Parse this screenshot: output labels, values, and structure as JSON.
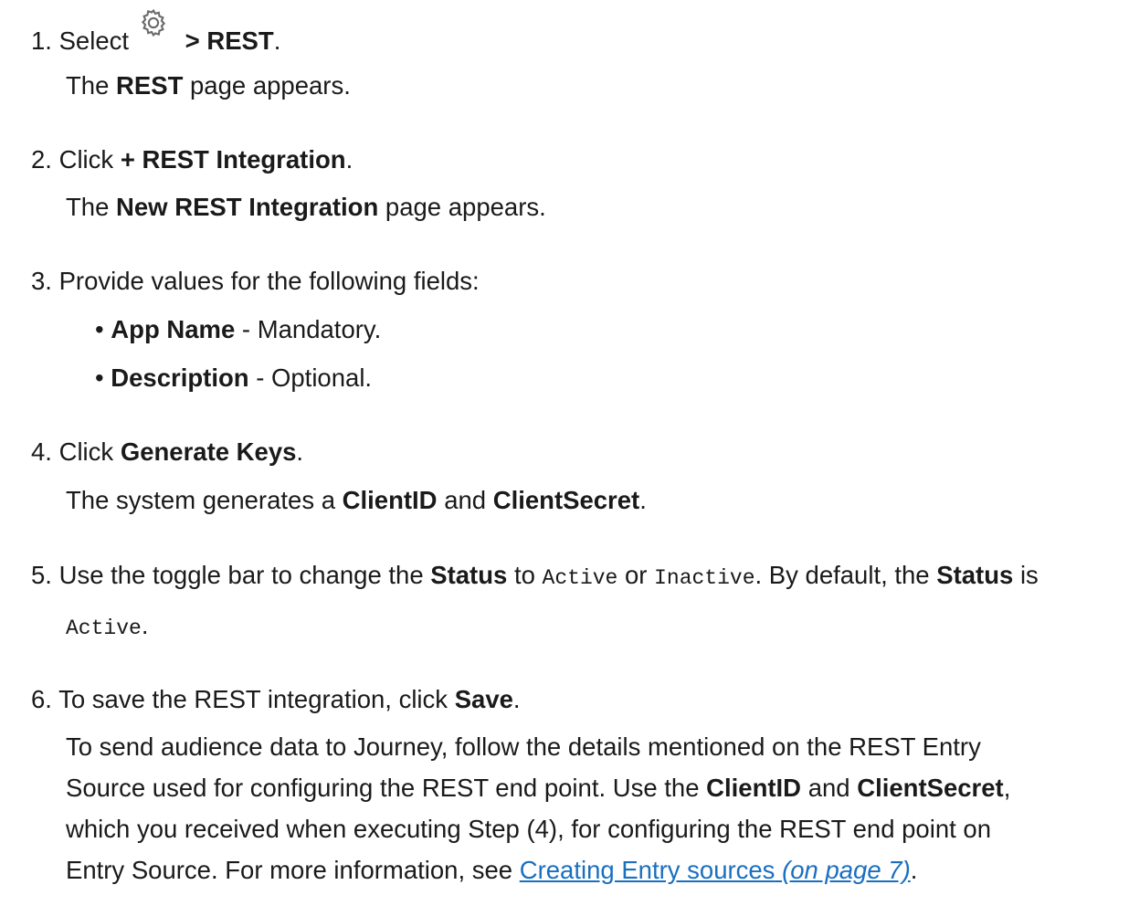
{
  "steps": [
    {
      "num": "1.",
      "lead": "Select",
      "icon": "gear-icon",
      "path": "> REST",
      "end": ".",
      "result": {
        "pre": "The",
        "bold": "REST",
        "post": "page appears."
      }
    },
    {
      "num": "2.",
      "lead": "Click",
      "bold": "+ REST Integration",
      "end": ".",
      "result": {
        "pre": "The",
        "bold": "New REST Integration",
        "post": "page appears."
      }
    },
    {
      "num": "3.",
      "text": "Provide values for the following fields:",
      "fields": [
        {
          "name": "App Name",
          "desc": " - Mandatory."
        },
        {
          "name": "Description",
          "desc": " - Optional."
        }
      ]
    },
    {
      "num": "4.",
      "lead": "Click",
      "bold": "Generate Keys",
      "end": ".",
      "result": {
        "pre": "The system generates a",
        "b1": "ClientID",
        "mid": "and",
        "b2": "ClientSecret",
        "end": "."
      }
    },
    {
      "num": "5.",
      "t1": "Use the toggle bar to change the",
      "b1": "Status",
      "t2": "to",
      "c1": "Active",
      "t3": "or",
      "c2": "Inactive",
      "t4": ". By default, the",
      "b2": "Status",
      "t5": "is",
      "c3": "Active",
      "end": "."
    },
    {
      "num": "6.",
      "lead": "To save the REST integration, click",
      "bold": "Save",
      "end": ".",
      "para": {
        "l1": "To send audience data to Journey, follow the details mentioned on the REST Entry",
        "l2a": "Source used for configuring the REST end point. Use the",
        "l2b": "ClientID",
        "l2c": "and",
        "l2d": "ClientSecret",
        "l2e": ",",
        "l3": "which you received when executing Step (4), for configuring the REST end point on",
        "l4a": "Entry Source. For more information, see",
        "link": "Creating Entry sources",
        "ref": "(on page 7)",
        "l4e": "."
      }
    }
  ],
  "colors": {
    "text": "#1a1a1a",
    "link": "#1a6fc0",
    "icon": "#6b6b6b"
  }
}
